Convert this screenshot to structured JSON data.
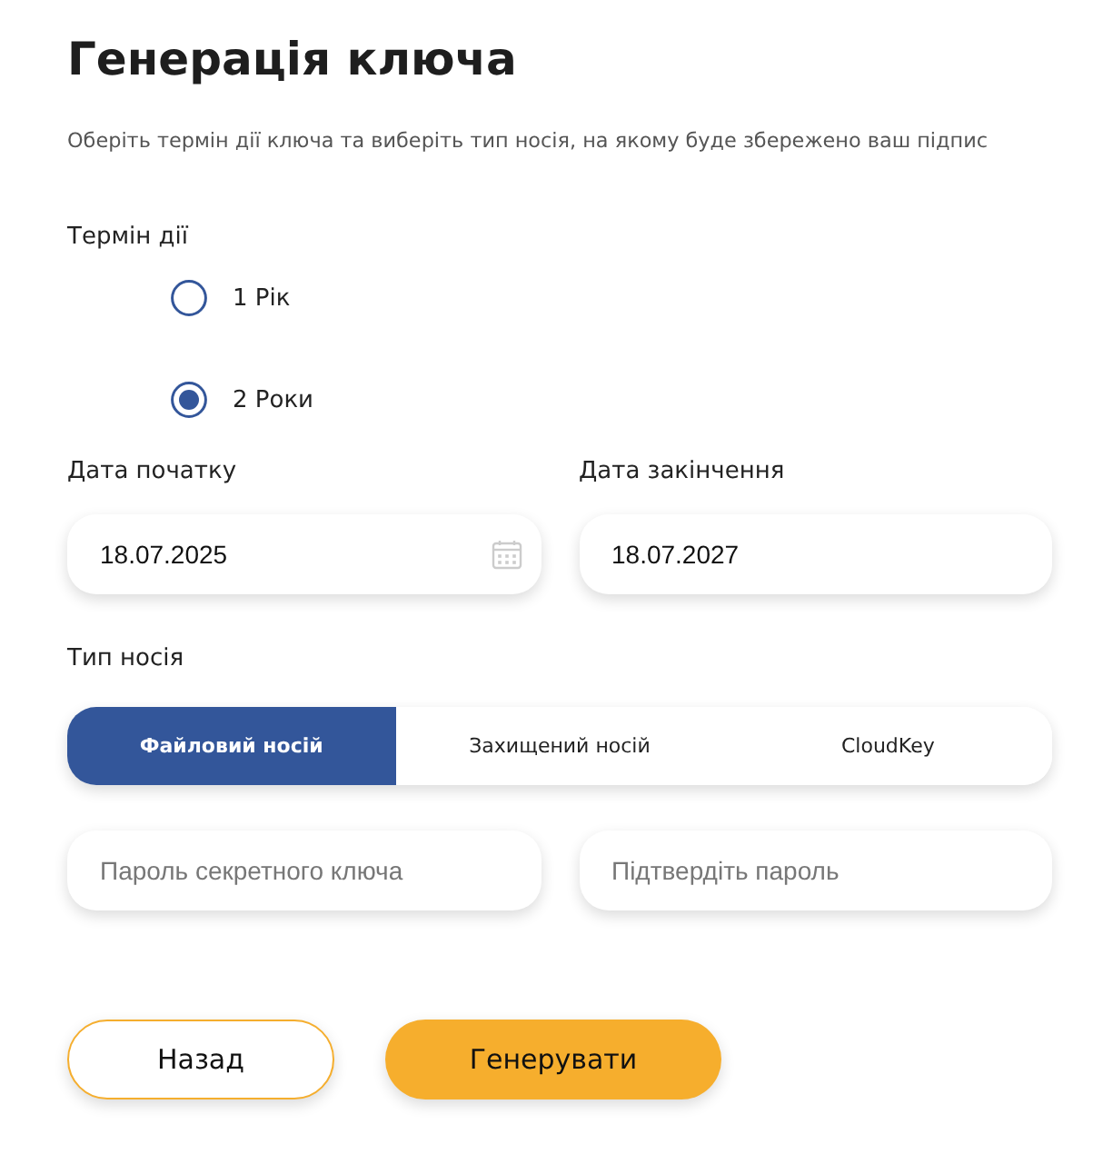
{
  "title": "Генерація ключа",
  "subtitle": "Оберіть термін дії ключа та виберіть тип носія, на якому буде збережено ваш підпис",
  "term": {
    "label": "Термін дії",
    "options": [
      {
        "label": "1 Рік",
        "selected": false
      },
      {
        "label": "2 Роки",
        "selected": true
      }
    ]
  },
  "dates": [
    {
      "label": "Дата початку",
      "value": "18.07.2025",
      "calendar": true
    },
    {
      "label": "Дата закінчення",
      "value": "18.07.2027",
      "calendar": false
    }
  ],
  "media": {
    "label": "Тип носія",
    "tabs": [
      {
        "label": "Файловий носій",
        "selected": true
      },
      {
        "label": "Захищений носій",
        "selected": false
      },
      {
        "label": "CloudKey",
        "selected": false
      }
    ]
  },
  "passwords": [
    {
      "placeholder": "Пароль секретного ключа"
    },
    {
      "placeholder": "Підтвердіть пароль"
    }
  ],
  "buttons": [
    {
      "label": "Назад",
      "kind": "secondary"
    },
    {
      "label": "Генерувати",
      "kind": "primary"
    }
  ]
}
